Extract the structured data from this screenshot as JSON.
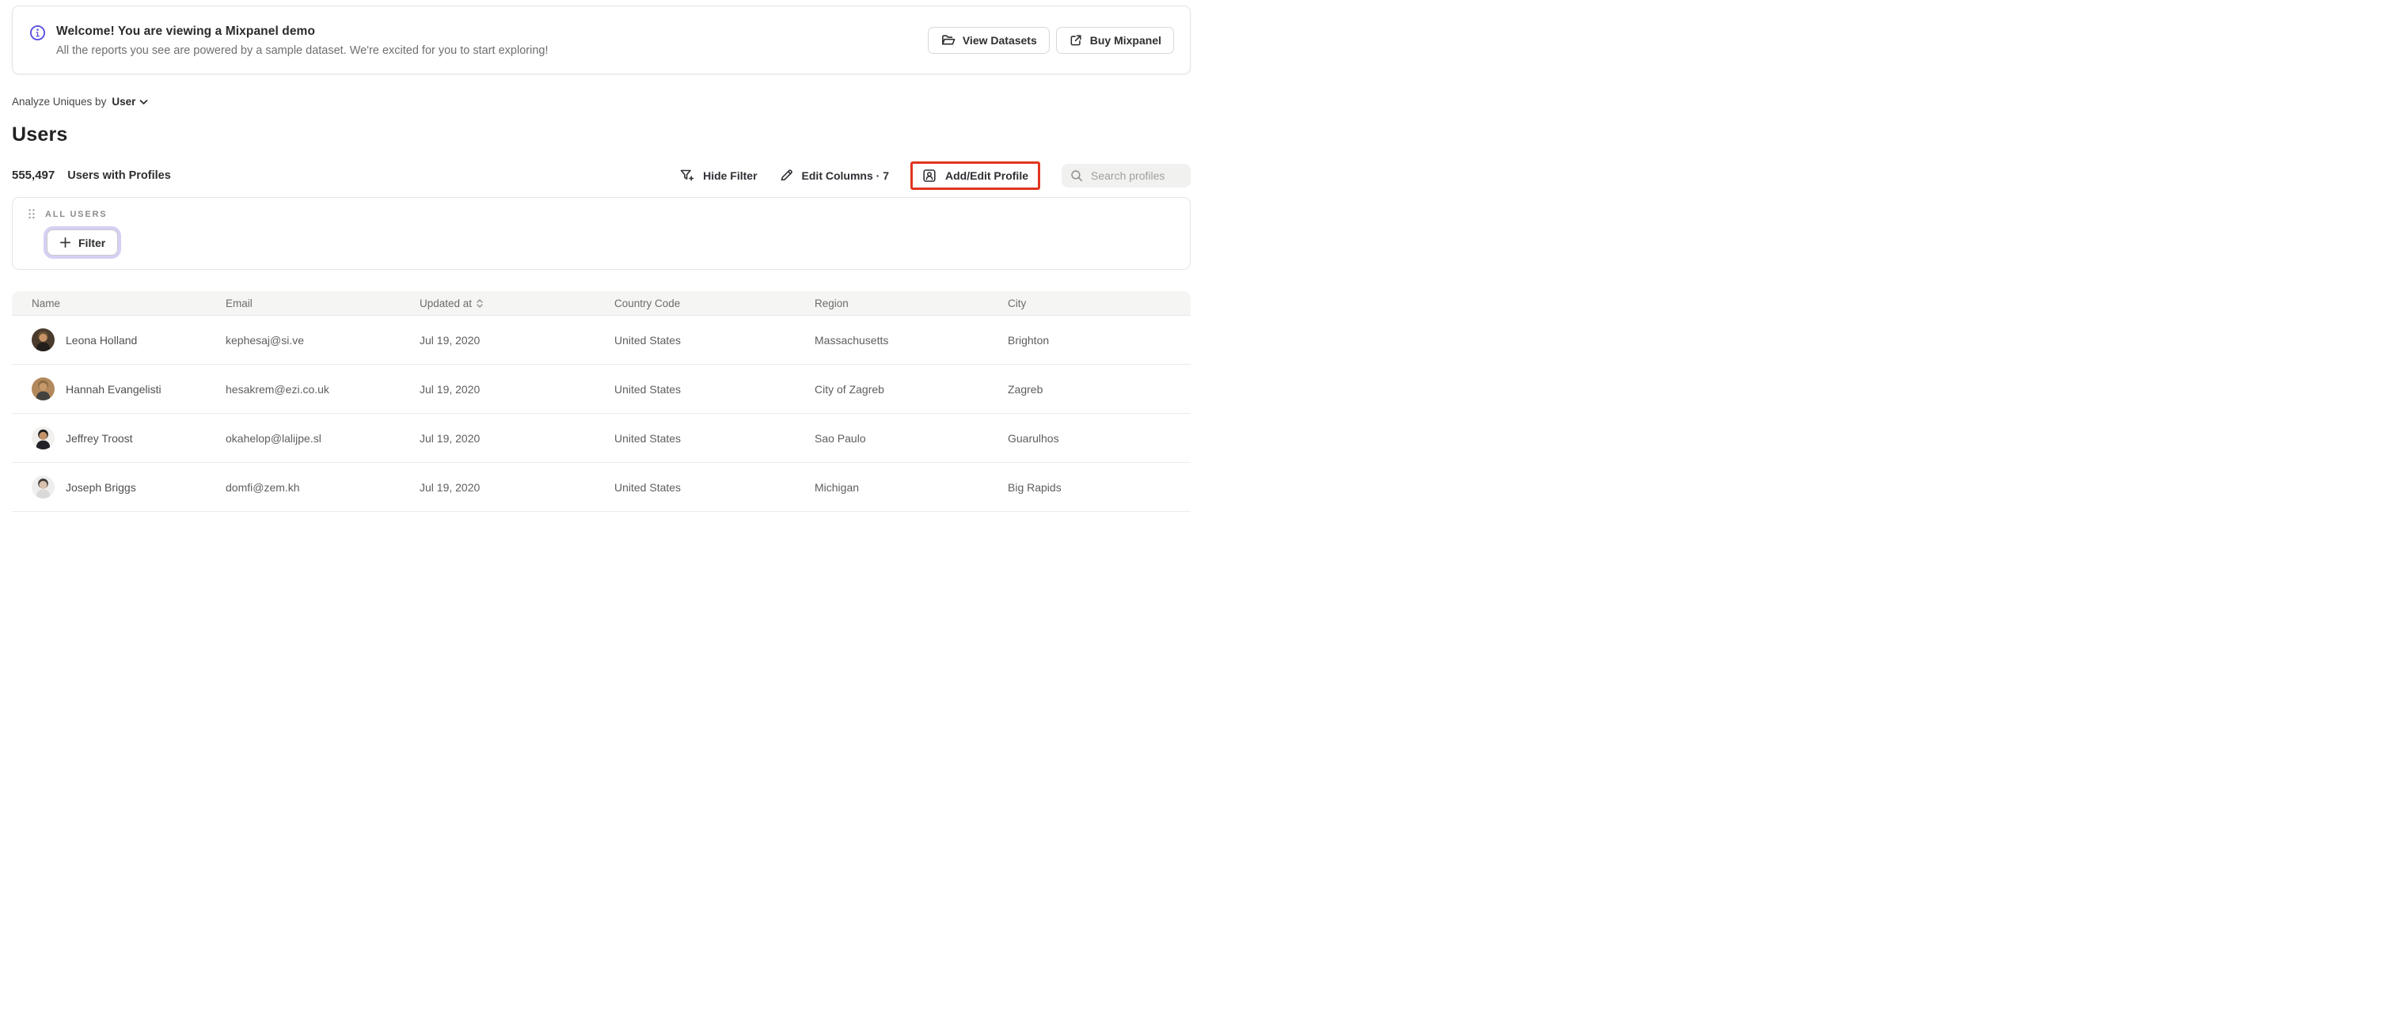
{
  "banner": {
    "title": "Welcome! You are viewing a Mixpanel demo",
    "subtitle": "All the reports you see are powered by a sample dataset. We're excited for you to start exploring!",
    "view_datasets_label": "View Datasets",
    "buy_mixpanel_label": "Buy Mixpanel"
  },
  "breadcrumb": {
    "prefix": "Analyze Uniques by",
    "selected": "User"
  },
  "page": {
    "title": "Users"
  },
  "stats": {
    "count": "555,497",
    "label": "Users with Profiles"
  },
  "toolbar": {
    "hide_filter_label": "Hide Filter",
    "edit_columns_label": "Edit Columns · 7",
    "add_edit_profile_label": "Add/Edit Profile",
    "search_placeholder": "Search profiles"
  },
  "filter_panel": {
    "group_label": "ALL USERS",
    "filter_button_label": "Filter"
  },
  "table": {
    "columns": [
      "Name",
      "Email",
      "Updated at",
      "Country Code",
      "Region",
      "City"
    ],
    "rows": [
      {
        "name": "Leona Holland",
        "email": "kephesaj@si.ve",
        "updated_at": "Jul 19, 2020",
        "country_code": "United States",
        "region": "Massachusetts",
        "city": "Brighton",
        "avatar": {
          "bg": "#4a3b2d",
          "hair": "#6b5233",
          "skin": "#c89468",
          "shirt": "#241f1b"
        }
      },
      {
        "name": "Hannah Evangelisti",
        "email": "hesakrem@ezi.co.uk",
        "updated_at": "Jul 19, 2020",
        "country_code": "United States",
        "region": "City of Zagreb",
        "city": "Zagreb",
        "avatar": {
          "bg": "#b2885c",
          "hair": "#8a6b43",
          "skin": "#c79a6b",
          "shirt": "#44423f"
        }
      },
      {
        "name": "Jeffrey Troost",
        "email": "okahelop@lalijpe.sl",
        "updated_at": "Jul 19, 2020",
        "country_code": "United States",
        "region": "Sao Paulo",
        "city": "Guarulhos",
        "avatar": {
          "bg": "#f2f0ed",
          "hair": "#1d1b1c",
          "skin": "#c2936a",
          "shirt": "#222127"
        }
      },
      {
        "name": "Joseph Briggs",
        "email": "domfi@zem.kh",
        "updated_at": "Jul 19, 2020",
        "country_code": "United States",
        "region": "Michigan",
        "city": "Big Rapids",
        "avatar": {
          "bg": "#efeeee",
          "hair": "#413c38",
          "skin": "#d9c0ad",
          "shirt": "#dbd9d7"
        }
      }
    ]
  },
  "colors": {
    "accent_purple": "#5b50e2",
    "focus_ring_lavender": "#d5d0f4",
    "annotation_red": "#e0351f",
    "table_header_bg": "#f5f5f4"
  }
}
